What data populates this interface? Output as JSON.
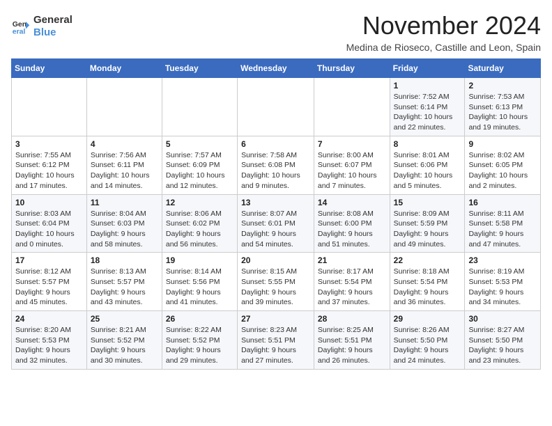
{
  "header": {
    "logo_line1": "General",
    "logo_line2": "Blue",
    "month_title": "November 2024",
    "location": "Medina de Rioseco, Castille and Leon, Spain"
  },
  "weekdays": [
    "Sunday",
    "Monday",
    "Tuesday",
    "Wednesday",
    "Thursday",
    "Friday",
    "Saturday"
  ],
  "weeks": [
    [
      {
        "day": "",
        "info": ""
      },
      {
        "day": "",
        "info": ""
      },
      {
        "day": "",
        "info": ""
      },
      {
        "day": "",
        "info": ""
      },
      {
        "day": "",
        "info": ""
      },
      {
        "day": "1",
        "info": "Sunrise: 7:52 AM\nSunset: 6:14 PM\nDaylight: 10 hours\nand 22 minutes."
      },
      {
        "day": "2",
        "info": "Sunrise: 7:53 AM\nSunset: 6:13 PM\nDaylight: 10 hours\nand 19 minutes."
      }
    ],
    [
      {
        "day": "3",
        "info": "Sunrise: 7:55 AM\nSunset: 6:12 PM\nDaylight: 10 hours\nand 17 minutes."
      },
      {
        "day": "4",
        "info": "Sunrise: 7:56 AM\nSunset: 6:11 PM\nDaylight: 10 hours\nand 14 minutes."
      },
      {
        "day": "5",
        "info": "Sunrise: 7:57 AM\nSunset: 6:09 PM\nDaylight: 10 hours\nand 12 minutes."
      },
      {
        "day": "6",
        "info": "Sunrise: 7:58 AM\nSunset: 6:08 PM\nDaylight: 10 hours\nand 9 minutes."
      },
      {
        "day": "7",
        "info": "Sunrise: 8:00 AM\nSunset: 6:07 PM\nDaylight: 10 hours\nand 7 minutes."
      },
      {
        "day": "8",
        "info": "Sunrise: 8:01 AM\nSunset: 6:06 PM\nDaylight: 10 hours\nand 5 minutes."
      },
      {
        "day": "9",
        "info": "Sunrise: 8:02 AM\nSunset: 6:05 PM\nDaylight: 10 hours\nand 2 minutes."
      }
    ],
    [
      {
        "day": "10",
        "info": "Sunrise: 8:03 AM\nSunset: 6:04 PM\nDaylight: 10 hours\nand 0 minutes."
      },
      {
        "day": "11",
        "info": "Sunrise: 8:04 AM\nSunset: 6:03 PM\nDaylight: 9 hours\nand 58 minutes."
      },
      {
        "day": "12",
        "info": "Sunrise: 8:06 AM\nSunset: 6:02 PM\nDaylight: 9 hours\nand 56 minutes."
      },
      {
        "day": "13",
        "info": "Sunrise: 8:07 AM\nSunset: 6:01 PM\nDaylight: 9 hours\nand 54 minutes."
      },
      {
        "day": "14",
        "info": "Sunrise: 8:08 AM\nSunset: 6:00 PM\nDaylight: 9 hours\nand 51 minutes."
      },
      {
        "day": "15",
        "info": "Sunrise: 8:09 AM\nSunset: 5:59 PM\nDaylight: 9 hours\nand 49 minutes."
      },
      {
        "day": "16",
        "info": "Sunrise: 8:11 AM\nSunset: 5:58 PM\nDaylight: 9 hours\nand 47 minutes."
      }
    ],
    [
      {
        "day": "17",
        "info": "Sunrise: 8:12 AM\nSunset: 5:57 PM\nDaylight: 9 hours\nand 45 minutes."
      },
      {
        "day": "18",
        "info": "Sunrise: 8:13 AM\nSunset: 5:57 PM\nDaylight: 9 hours\nand 43 minutes."
      },
      {
        "day": "19",
        "info": "Sunrise: 8:14 AM\nSunset: 5:56 PM\nDaylight: 9 hours\nand 41 minutes."
      },
      {
        "day": "20",
        "info": "Sunrise: 8:15 AM\nSunset: 5:55 PM\nDaylight: 9 hours\nand 39 minutes."
      },
      {
        "day": "21",
        "info": "Sunrise: 8:17 AM\nSunset: 5:54 PM\nDaylight: 9 hours\nand 37 minutes."
      },
      {
        "day": "22",
        "info": "Sunrise: 8:18 AM\nSunset: 5:54 PM\nDaylight: 9 hours\nand 36 minutes."
      },
      {
        "day": "23",
        "info": "Sunrise: 8:19 AM\nSunset: 5:53 PM\nDaylight: 9 hours\nand 34 minutes."
      }
    ],
    [
      {
        "day": "24",
        "info": "Sunrise: 8:20 AM\nSunset: 5:53 PM\nDaylight: 9 hours\nand 32 minutes."
      },
      {
        "day": "25",
        "info": "Sunrise: 8:21 AM\nSunset: 5:52 PM\nDaylight: 9 hours\nand 30 minutes."
      },
      {
        "day": "26",
        "info": "Sunrise: 8:22 AM\nSunset: 5:52 PM\nDaylight: 9 hours\nand 29 minutes."
      },
      {
        "day": "27",
        "info": "Sunrise: 8:23 AM\nSunset: 5:51 PM\nDaylight: 9 hours\nand 27 minutes."
      },
      {
        "day": "28",
        "info": "Sunrise: 8:25 AM\nSunset: 5:51 PM\nDaylight: 9 hours\nand 26 minutes."
      },
      {
        "day": "29",
        "info": "Sunrise: 8:26 AM\nSunset: 5:50 PM\nDaylight: 9 hours\nand 24 minutes."
      },
      {
        "day": "30",
        "info": "Sunrise: 8:27 AM\nSunset: 5:50 PM\nDaylight: 9 hours\nand 23 minutes."
      }
    ]
  ]
}
